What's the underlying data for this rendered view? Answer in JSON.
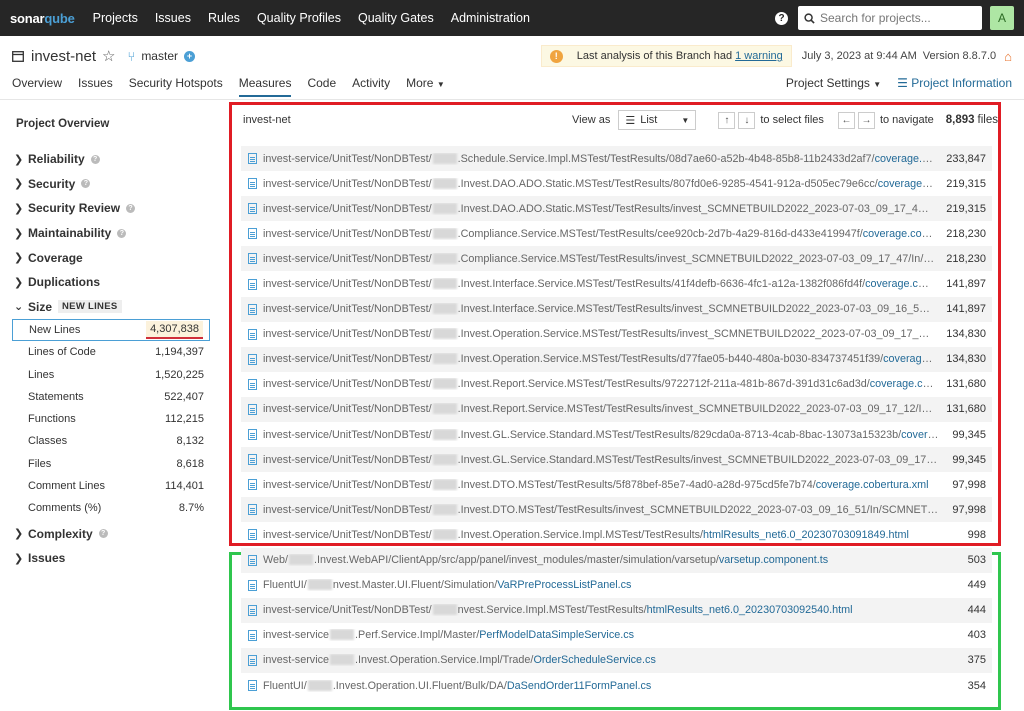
{
  "nav": {
    "logo_prefix": "sonar",
    "logo_suffix": "qube",
    "links": [
      "Projects",
      "Issues",
      "Rules",
      "Quality Profiles",
      "Quality Gates",
      "Administration"
    ],
    "search_placeholder": "Search for projects...",
    "help_glyph": "?",
    "avatar_letter": "A"
  },
  "project": {
    "name": "invest-net",
    "branch": "master",
    "warning_text": "Last analysis of this Branch had",
    "warning_link": "1 warning",
    "analysis_date": "July 3, 2023 at 9:44 AM",
    "version": "Version 8.8.7.0"
  },
  "tabs": [
    "Overview",
    "Issues",
    "Security Hotspots",
    "Measures",
    "Code",
    "Activity",
    "More"
  ],
  "tab_active": "Measures",
  "project_settings": "Project Settings",
  "project_information": "Project Information",
  "sidebar": {
    "title": "Project Overview",
    "domains_top": [
      "Reliability",
      "Security",
      "Security Review",
      "Maintainability",
      "Coverage",
      "Duplications"
    ],
    "size_label": "Size",
    "new_lines_badge": "NEW LINES",
    "metrics": [
      {
        "label": "New Lines",
        "value": "4,307,838"
      },
      {
        "label": "Lines of Code",
        "value": "1,194,397"
      },
      {
        "label": "Lines",
        "value": "1,520,225"
      },
      {
        "label": "Statements",
        "value": "522,407"
      },
      {
        "label": "Functions",
        "value": "112,215"
      },
      {
        "label": "Classes",
        "value": "8,132"
      },
      {
        "label": "Files",
        "value": "8,618"
      },
      {
        "label": "Comment Lines",
        "value": "114,401"
      },
      {
        "label": "Comments (%)",
        "value": "8.7%"
      }
    ],
    "domains_bottom": [
      "Complexity",
      "Issues"
    ]
  },
  "list": {
    "breadcrumb": "invest-net",
    "view_as_label": "View as",
    "view_as_value": "List",
    "select_hint": "to select files",
    "navigate_hint": "to navigate",
    "files_count": "8,893",
    "files_label": "files"
  },
  "rows": [
    {
      "dir": "invest-service/UnitTest/NonDBTest/",
      "rest": ".Schedule.Service.Impl.MSTest/TestResults/08d7ae60-a52b-4b48-85b8-11b2433d2af7/",
      "file": "coverage.cobertura.xml",
      "value": "233,847"
    },
    {
      "dir": "invest-service/UnitTest/NonDBTest/",
      "rest": ".Invest.DAO.ADO.Static.MSTest/TestResults/807fd0e6-9285-4541-912a-d505ec79e6cc/",
      "file": "coverage.cobertura.xml",
      "value": "219,315"
    },
    {
      "dir": "invest-service/UnitTest/NonDBTest/",
      "rest": ".Invest.DAO.ADO.Static.MSTest/TestResults/invest_SCMNETBUILD2022_2023-07-03_09_17_47/In/SCMNETBUILD202...",
      "file": "",
      "value": "219,315"
    },
    {
      "dir": "invest-service/UnitTest/NonDBTest/",
      "rest": ".Compliance.Service.MSTest/TestResults/cee920cb-2d7b-4a29-816d-d433e419947f/",
      "file": "coverage.cobertura.xml",
      "value": "218,230"
    },
    {
      "dir": "invest-service/UnitTest/NonDBTest/",
      "rest": ".Compliance.Service.MSTest/TestResults/invest_SCMNETBUILD2022_2023-07-03_09_17_47/In/SCMNETBUILD2022/c...",
      "file": "",
      "value": "218,230"
    },
    {
      "dir": "invest-service/UnitTest/NonDBTest/",
      "rest": ".Invest.Interface.Service.MSTest/TestResults/41f4defb-6636-4fc1-a12a-1382f086fd4f/",
      "file": "coverage.cobertura.xml",
      "value": "141,897"
    },
    {
      "dir": "invest-service/UnitTest/NonDBTest/",
      "rest": ".Invest.Interface.Service.MSTest/TestResults/invest_SCMNETBUILD2022_2023-07-03_09_16_59/In/SCMNETBUILD202...",
      "file": "",
      "value": "141,897"
    },
    {
      "dir": "invest-service/UnitTest/NonDBTest/",
      "rest": ".Invest.Operation.Service.MSTest/TestResults/invest_SCMNETBUILD2022_2023-07-03_09_17_00/In/SCMNETBUILD20...",
      "file": "",
      "value": "134,830"
    },
    {
      "dir": "invest-service/UnitTest/NonDBTest/",
      "rest": ".Invest.Operation.Service.MSTest/TestResults/d77fae05-b440-480a-b030-834737451f39/",
      "file": "coverage.cobertura.xml",
      "value": "134,830"
    },
    {
      "dir": "invest-service/UnitTest/NonDBTest/",
      "rest": ".Invest.Report.Service.MSTest/TestResults/9722712f-211a-481b-867d-391d31c6ad3d/",
      "file": "coverage.cobertura.xml",
      "value": "131,680"
    },
    {
      "dir": "invest-service/UnitTest/NonDBTest/",
      "rest": ".Invest.Report.Service.MSTest/TestResults/invest_SCMNETBUILD2022_2023-07-03_09_17_12/In/SCMNETBUILD2022/...",
      "file": "",
      "value": "131,680"
    },
    {
      "dir": "invest-service/UnitTest/NonDBTest/",
      "rest": ".Invest.GL.Service.Standard.MSTest/TestResults/829cda0a-8713-4cab-8bac-13073a15323b/",
      "file": "coverage.cobertura.xml",
      "value": "99,345"
    },
    {
      "dir": "invest-service/UnitTest/NonDBTest/",
      "rest": ".Invest.GL.Service.Standard.MSTest/TestResults/invest_SCMNETBUILD2022_2023-07-03_09_17_28/In/SCMNETBUIL...",
      "file": "",
      "value": "99,345"
    },
    {
      "dir": "invest-service/UnitTest/NonDBTest/",
      "rest": ".Invest.DTO.MSTest/TestResults/5f878bef-85e7-4ad0-a28d-975cd5fe7b74/",
      "file": "coverage.cobertura.xml",
      "value": "97,998"
    },
    {
      "dir": "invest-service/UnitTest/NonDBTest/",
      "rest": ".Invest.DTO.MSTest/TestResults/invest_SCMNETBUILD2022_2023-07-03_09_16_51/In/SCMNETBUILD2022/",
      "file": "coverage...",
      "value": "97,998"
    },
    {
      "dir": "invest-service/UnitTest/NonDBTest/",
      "rest": ".Invest.Operation.Service.Impl.MSTest/TestResults/",
      "file": "htmlResults_net6.0_20230703091849.html",
      "value": "998"
    },
    {
      "dir": "Web/",
      "rest": ".Invest.WebAPI/ClientApp/src/app/panel/invest_modules/master/simulation/varsetup/",
      "file": "varsetup.component.ts",
      "value": "503"
    },
    {
      "dir": "FluentUI/",
      "rest": "nvest.Master.UI.Fluent/Simulation/",
      "file": "VaRPreProcessListPanel.cs",
      "value": "449"
    },
    {
      "dir": "invest-service/UnitTest/NonDBTest/",
      "rest": "nvest.Service.Impl.MSTest/TestResults/",
      "file": "htmlResults_net6.0_20230703092540.html",
      "value": "444"
    },
    {
      "dir": "invest-service",
      "rest": ".Perf.Service.Impl/Master/",
      "file": "PerfModelDataSimpleService.cs",
      "value": "403"
    },
    {
      "dir": "invest-service",
      "rest": ".Invest.Operation.Service.Impl/Trade/",
      "file": "OrderScheduleService.cs",
      "value": "375"
    },
    {
      "dir": "FluentUI/",
      "rest": ".Invest.Operation.UI.Fluent/Bulk/DA/",
      "file": "DaSendOrder11FormPanel.cs",
      "value": "354"
    }
  ]
}
